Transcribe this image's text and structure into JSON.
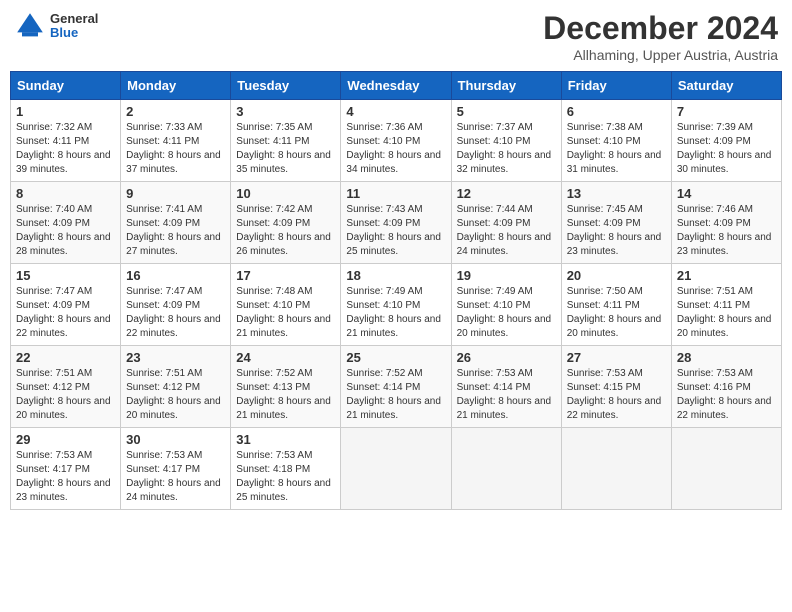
{
  "header": {
    "logo_general": "General",
    "logo_blue": "Blue",
    "month_title": "December 2024",
    "subtitle": "Allhaming, Upper Austria, Austria"
  },
  "weekdays": [
    "Sunday",
    "Monday",
    "Tuesday",
    "Wednesday",
    "Thursday",
    "Friday",
    "Saturday"
  ],
  "weeks": [
    [
      {
        "day": "1",
        "sunrise": "7:32 AM",
        "sunset": "4:11 PM",
        "daylight": "8 hours and 39 minutes."
      },
      {
        "day": "2",
        "sunrise": "7:33 AM",
        "sunset": "4:11 PM",
        "daylight": "8 hours and 37 minutes."
      },
      {
        "day": "3",
        "sunrise": "7:35 AM",
        "sunset": "4:11 PM",
        "daylight": "8 hours and 35 minutes."
      },
      {
        "day": "4",
        "sunrise": "7:36 AM",
        "sunset": "4:10 PM",
        "daylight": "8 hours and 34 minutes."
      },
      {
        "day": "5",
        "sunrise": "7:37 AM",
        "sunset": "4:10 PM",
        "daylight": "8 hours and 32 minutes."
      },
      {
        "day": "6",
        "sunrise": "7:38 AM",
        "sunset": "4:10 PM",
        "daylight": "8 hours and 31 minutes."
      },
      {
        "day": "7",
        "sunrise": "7:39 AM",
        "sunset": "4:09 PM",
        "daylight": "8 hours and 30 minutes."
      }
    ],
    [
      {
        "day": "8",
        "sunrise": "7:40 AM",
        "sunset": "4:09 PM",
        "daylight": "8 hours and 28 minutes."
      },
      {
        "day": "9",
        "sunrise": "7:41 AM",
        "sunset": "4:09 PM",
        "daylight": "8 hours and 27 minutes."
      },
      {
        "day": "10",
        "sunrise": "7:42 AM",
        "sunset": "4:09 PM",
        "daylight": "8 hours and 26 minutes."
      },
      {
        "day": "11",
        "sunrise": "7:43 AM",
        "sunset": "4:09 PM",
        "daylight": "8 hours and 25 minutes."
      },
      {
        "day": "12",
        "sunrise": "7:44 AM",
        "sunset": "4:09 PM",
        "daylight": "8 hours and 24 minutes."
      },
      {
        "day": "13",
        "sunrise": "7:45 AM",
        "sunset": "4:09 PM",
        "daylight": "8 hours and 23 minutes."
      },
      {
        "day": "14",
        "sunrise": "7:46 AM",
        "sunset": "4:09 PM",
        "daylight": "8 hours and 23 minutes."
      }
    ],
    [
      {
        "day": "15",
        "sunrise": "7:47 AM",
        "sunset": "4:09 PM",
        "daylight": "8 hours and 22 minutes."
      },
      {
        "day": "16",
        "sunrise": "7:47 AM",
        "sunset": "4:09 PM",
        "daylight": "8 hours and 22 minutes."
      },
      {
        "day": "17",
        "sunrise": "7:48 AM",
        "sunset": "4:10 PM",
        "daylight": "8 hours and 21 minutes."
      },
      {
        "day": "18",
        "sunrise": "7:49 AM",
        "sunset": "4:10 PM",
        "daylight": "8 hours and 21 minutes."
      },
      {
        "day": "19",
        "sunrise": "7:49 AM",
        "sunset": "4:10 PM",
        "daylight": "8 hours and 20 minutes."
      },
      {
        "day": "20",
        "sunrise": "7:50 AM",
        "sunset": "4:11 PM",
        "daylight": "8 hours and 20 minutes."
      },
      {
        "day": "21",
        "sunrise": "7:51 AM",
        "sunset": "4:11 PM",
        "daylight": "8 hours and 20 minutes."
      }
    ],
    [
      {
        "day": "22",
        "sunrise": "7:51 AM",
        "sunset": "4:12 PM",
        "daylight": "8 hours and 20 minutes."
      },
      {
        "day": "23",
        "sunrise": "7:51 AM",
        "sunset": "4:12 PM",
        "daylight": "8 hours and 20 minutes."
      },
      {
        "day": "24",
        "sunrise": "7:52 AM",
        "sunset": "4:13 PM",
        "daylight": "8 hours and 21 minutes."
      },
      {
        "day": "25",
        "sunrise": "7:52 AM",
        "sunset": "4:14 PM",
        "daylight": "8 hours and 21 minutes."
      },
      {
        "day": "26",
        "sunrise": "7:53 AM",
        "sunset": "4:14 PM",
        "daylight": "8 hours and 21 minutes."
      },
      {
        "day": "27",
        "sunrise": "7:53 AM",
        "sunset": "4:15 PM",
        "daylight": "8 hours and 22 minutes."
      },
      {
        "day": "28",
        "sunrise": "7:53 AM",
        "sunset": "4:16 PM",
        "daylight": "8 hours and 22 minutes."
      }
    ],
    [
      {
        "day": "29",
        "sunrise": "7:53 AM",
        "sunset": "4:17 PM",
        "daylight": "8 hours and 23 minutes."
      },
      {
        "day": "30",
        "sunrise": "7:53 AM",
        "sunset": "4:17 PM",
        "daylight": "8 hours and 24 minutes."
      },
      {
        "day": "31",
        "sunrise": "7:53 AM",
        "sunset": "4:18 PM",
        "daylight": "8 hours and 25 minutes."
      },
      null,
      null,
      null,
      null
    ]
  ],
  "labels": {
    "sunrise_prefix": "Sunrise: ",
    "sunset_prefix": "Sunset: ",
    "daylight_prefix": "Daylight: "
  }
}
